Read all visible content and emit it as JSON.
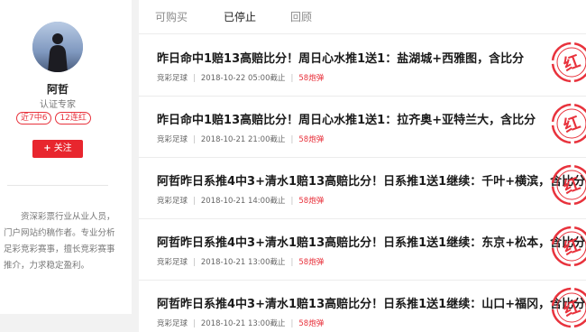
{
  "profile": {
    "name": "阿哲",
    "title": "认证专家",
    "badges": [
      "近7中6",
      "12连红"
    ],
    "follow_label": "关注",
    "bio": "资深彩票行业从业人员，门户网站约稿作者。专业分析足彩竞彩赛事，擅长竞彩赛事推介，力求稳定盈利。"
  },
  "tabs": [
    {
      "label": "可购买",
      "active": false
    },
    {
      "label": "已停止",
      "active": true
    },
    {
      "label": "回顾",
      "active": false
    }
  ],
  "articles": [
    {
      "title": "昨日命中1赔13高赔比分！周日心水推1送1：盐湖城+西雅图，含比分",
      "category": "竞彩足球",
      "date": "2018-10-22 05:00截止",
      "price": "58炮弹",
      "stamp_text": "红"
    },
    {
      "title": "昨日命中1赔13高赔比分！周日心水推1送1：拉齐奥+亚特兰大，含比分",
      "category": "竞彩足球",
      "date": "2018-10-21 21:00截止",
      "price": "58炮弹",
      "stamp_text": "红"
    },
    {
      "title": "阿哲昨日系推4中3+清水1赔13高赔比分！日系推1送1继续：千叶+横滨，含比分",
      "category": "竞彩足球",
      "date": "2018-10-21 14:00截止",
      "price": "58炮弹",
      "stamp_text": "红"
    },
    {
      "title": "阿哲昨日系推4中3+清水1赔13高赔比分！日系推1送1继续：东京+松本，含比分",
      "category": "竞彩足球",
      "date": "2018-10-21 13:00截止",
      "price": "58炮弹",
      "stamp_text": "红"
    },
    {
      "title": "阿哲昨日系推4中3+清水1赔13高赔比分！日系推1送1继续：山口+福冈，含比分",
      "category": "竞彩足球",
      "date": "2018-10-21 13:00截止",
      "price": "58炮弹",
      "stamp_text": "红"
    }
  ],
  "colors": {
    "accent": "#e8262e",
    "stamp": "#e8323c"
  },
  "icons": {
    "avatar": "person-silhouette-avatar",
    "stamp": "red-hit-stamp-icon"
  }
}
